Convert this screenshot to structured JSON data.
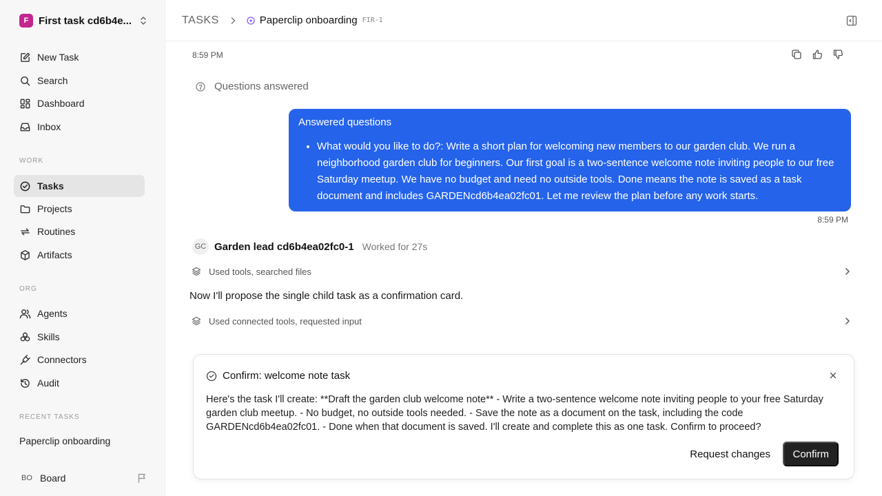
{
  "workspace": {
    "initial": "F",
    "name": "First task cd6b4e..."
  },
  "nav_main": [
    {
      "label": "New Task",
      "icon": "edit-icon"
    },
    {
      "label": "Search",
      "icon": "search-icon"
    },
    {
      "label": "Dashboard",
      "icon": "dashboard-icon"
    },
    {
      "label": "Inbox",
      "icon": "inbox-icon"
    }
  ],
  "section_work": "WORK",
  "nav_work": [
    {
      "label": "Tasks",
      "icon": "check-circle-icon",
      "active": true
    },
    {
      "label": "Projects",
      "icon": "folder-icon"
    },
    {
      "label": "Routines",
      "icon": "repeat-icon"
    },
    {
      "label": "Artifacts",
      "icon": "box-icon"
    }
  ],
  "section_org": "ORG",
  "nav_org": [
    {
      "label": "Agents",
      "icon": "users-icon"
    },
    {
      "label": "Skills",
      "icon": "skills-icon"
    },
    {
      "label": "Connectors",
      "icon": "plug-icon"
    },
    {
      "label": "Audit",
      "icon": "history-icon"
    }
  ],
  "section_recent": "RECENT TASKS",
  "recent_tasks": [
    "Paperclip onboarding"
  ],
  "board": {
    "initials": "BO",
    "label": "Board"
  },
  "header": {
    "root": "TASKS",
    "title": "Paperclip onboarding",
    "code": "FIR-1"
  },
  "thread": {
    "time_top": "8:59 PM",
    "questions_label": "Questions answered",
    "bubble_title": "Answered questions",
    "bubble_item": "What would you like to do?: Write a short plan for welcoming new members to our garden club. We run a neighborhood garden club for beginners. Our first goal is a two-sentence welcome note inviting people to our free Saturday meetup. We have no budget and need no outside tools. Done means the note is saved as a task document and includes GARDENcd6b4ea02fc01. Let me review the plan before any work starts.",
    "bubble_time": "8:59 PM",
    "agent_initials": "GC",
    "agent_name": "Garden lead cd6b4ea02fc0-1",
    "agent_meta": "Worked for 27s",
    "tool_row_1": "Used tools, searched files",
    "agent_message": "Now I'll propose the single child task as a confirmation card.",
    "tool_row_2": "Used connected tools, requested input"
  },
  "confirm_card": {
    "title": "Confirm: welcome note task",
    "body": "Here's the task I'll create: **Draft the garden club welcome note** - Write a two-sentence welcome note inviting people to your free Saturday garden club meetup. - No budget, no outside tools needed. - Save the note as a document on the task, including the code GARDENcd6b4ea02fc01. - Done when that document is saved. I'll create and complete this as one task. Confirm to proceed?",
    "secondary_label": "Request changes",
    "primary_label": "Confirm"
  },
  "colors": {
    "accent": "#2563eb",
    "workspace_logo": "#c3268f",
    "primary_button": "#222222",
    "status_purple": "#8b5cf6"
  }
}
